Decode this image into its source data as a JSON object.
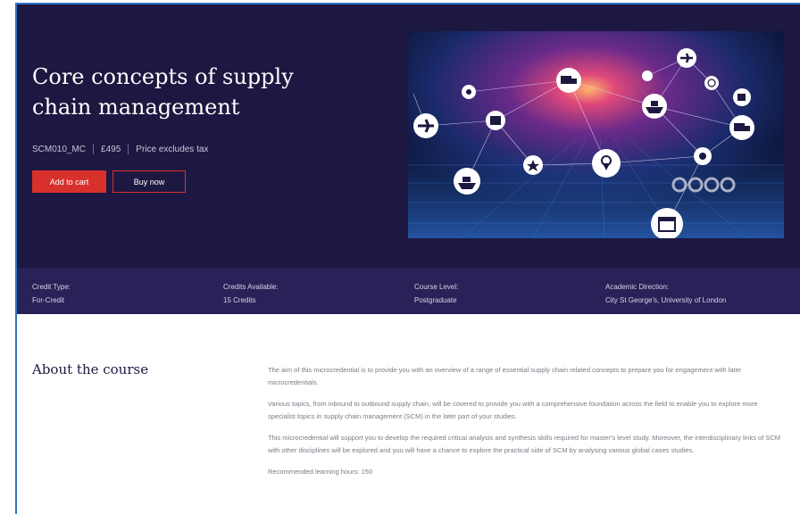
{
  "course": {
    "title": "Core concepts of supply chain management",
    "code": "SCM010_MC",
    "price": "£495",
    "tax_note": "Price excludes tax"
  },
  "buttons": {
    "add_to_cart": "Add to cart",
    "buy_now": "Buy now"
  },
  "hero_image": {
    "subject": "supply chain network illustration over world map",
    "icons": [
      "airplane-icon",
      "truck-icon",
      "ship-icon",
      "location-pin-icon",
      "star-icon",
      "calendar-icon",
      "package-icon",
      "forklift-icon",
      "globe-icon"
    ]
  },
  "info": [
    {
      "label": "Credit Type:",
      "value": "For-Credit"
    },
    {
      "label": "Credits Available:",
      "value": "15 Credits"
    },
    {
      "label": "Course Level:",
      "value": "Postgraduate"
    },
    {
      "label": "Academic Direction:",
      "value": "City St George's, University of London"
    }
  ],
  "about": {
    "heading": "About the course",
    "paragraphs": [
      "The aim of this microcredential is to provide you with an overview of a range of essential supply chain related concepts to prepare you for engagement with later microcredentials.",
      "Various topics, from inbound to outbound supply chain, will be covered to provide you with a comprehensive foundation across the field to enable you to explore more specialist topics in supply chain management (SCM) in the later part of your studies.",
      "This microcredential will support you to develop the required critical analysis and synthesis skills required for master's level study. Moreover, the interdisciplinary links of SCM with other disciplines will be explored and you will have a chance to explore the practical side of SCM by analysing various global cases studies.",
      "Recommended learning hours: 150"
    ]
  },
  "colors": {
    "hero_bg": "#1d1841",
    "info_bar_bg": "#292258",
    "accent_red": "#d8312c",
    "heading_navy": "#1d1841"
  }
}
